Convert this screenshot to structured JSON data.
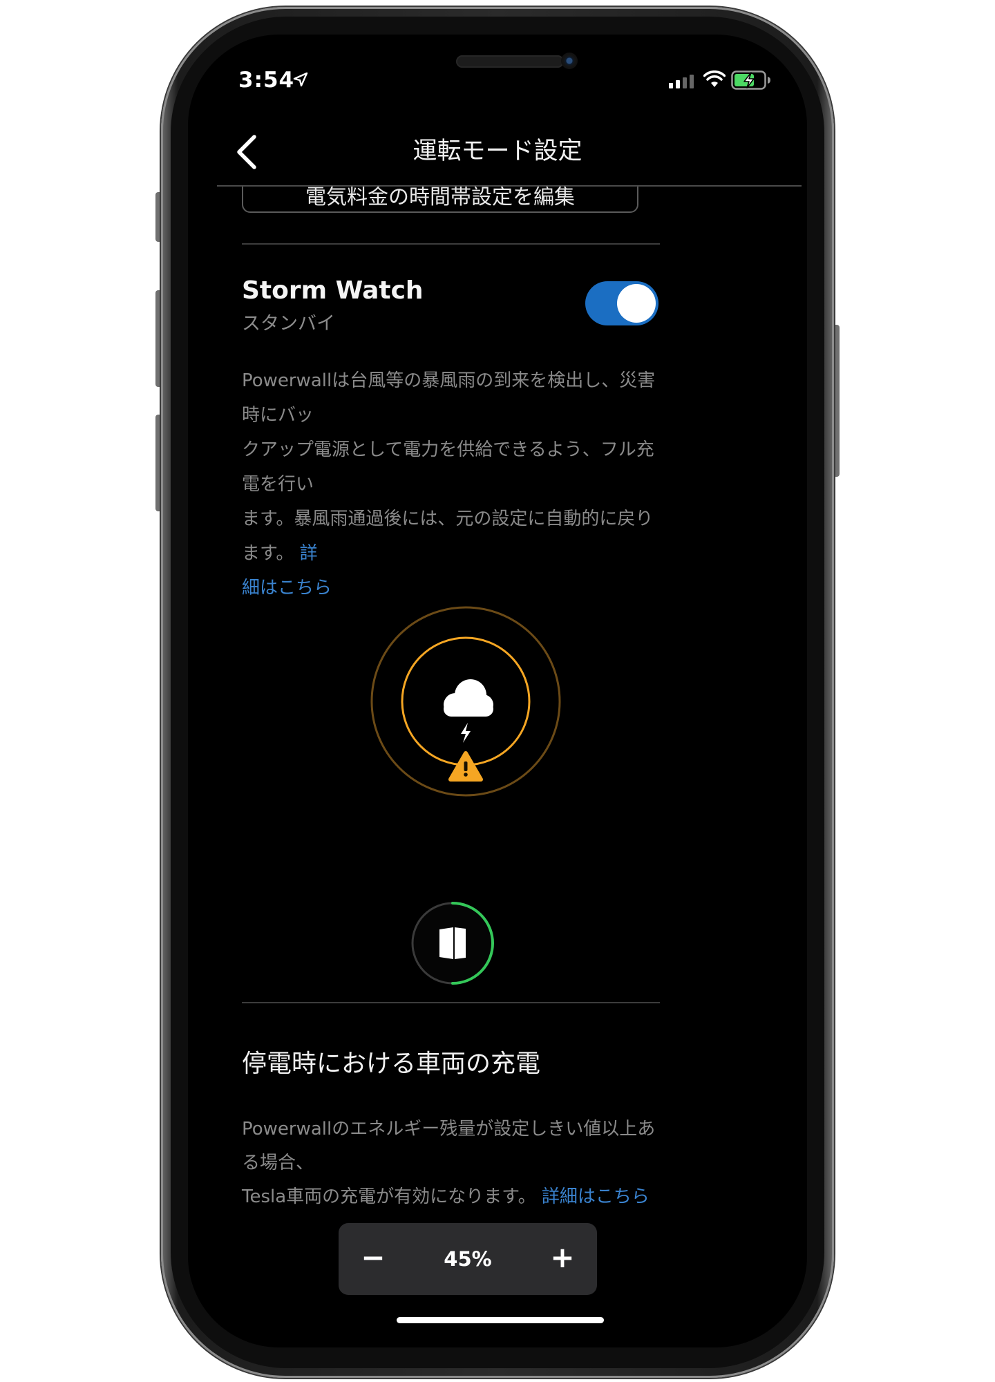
{
  "status_bar": {
    "time": "3:54",
    "icons": [
      "location-arrow-icon",
      "cellular-signal-icon",
      "wifi-icon",
      "battery-charging-icon"
    ],
    "battery_color": "#4cd964"
  },
  "nav": {
    "title": "運転モード設定",
    "back_icon": "chevron-left-icon"
  },
  "edit_button": {
    "label": "電気料金の時間帯設定を編集"
  },
  "storm_watch": {
    "title": "Storm Watch",
    "status": "スタンバイ",
    "enabled": true,
    "toggle_color": "#1b6ec2",
    "description": [
      "Powerwallは台風等の暴風雨の到来を検出し、災害時にバッ",
      "クアップ電源として電力を供給できるよう、フル充電を行い",
      "ます。暴風雨通過後には、元の設定に自動的に戻ります。"
    ],
    "link_start": "詳",
    "link_end": "細はこちら",
    "link_color": "#3a83cf",
    "graphic": {
      "icons": [
        "storm-cloud-icon",
        "lightning-bolt-icon",
        "warning-triangle-icon"
      ],
      "accent_color": "#f5a623"
    },
    "powerwall": {
      "icon": "powerwall-icon",
      "charge_fraction": 0.5,
      "ring_color": "#34c759"
    }
  },
  "vehicle_charging": {
    "title": "停電時における車両の充電",
    "description": [
      "Powerwallのエネルギー残量が設定しきい値以上ある場合、",
      "Tesla車両の充電が有効になります。"
    ],
    "link": "詳細はこちら",
    "threshold": {
      "minus_label": "−",
      "value": "45%",
      "plus_label": "+"
    }
  }
}
